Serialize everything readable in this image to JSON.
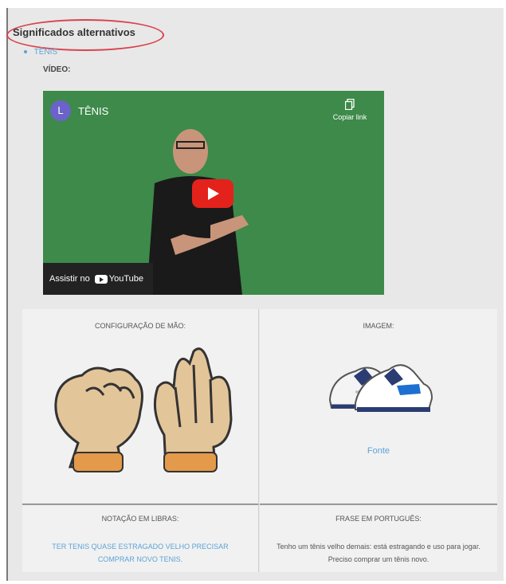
{
  "section": {
    "heading": "Significados alternativos",
    "alt_item": "TÊNIS",
    "video_label": "VÍDEO:"
  },
  "video": {
    "avatar_letter": "L",
    "title": "TÊNIS",
    "copy_link_label": "Copiar link",
    "watch_on_label": "Assistir no",
    "youtube_label": "YouTube",
    "background_color": "#3d8a4a"
  },
  "table": {
    "hand_config_title": "CONFIGURAÇÃO DE MÃO:",
    "image_title": "IMAGEM:",
    "source_link": "Fonte",
    "notation_title": "NOTAÇÃO EM LIBRAS:",
    "notation_text": "TER TENIS QUASE ESTRAGADO VELHO PRECISAR COMPRAR NOVO TENIS.",
    "phrase_title": "FRASE EM PORTUGUÊS:",
    "phrase_text": "Tenho um tênis velho demais: está estragando e uso para jogar. Preciso comprar um tênis novo."
  },
  "colors": {
    "link": "#5da3d6",
    "highlight_circle": "#d9434f",
    "play_button": "#e3221b"
  }
}
